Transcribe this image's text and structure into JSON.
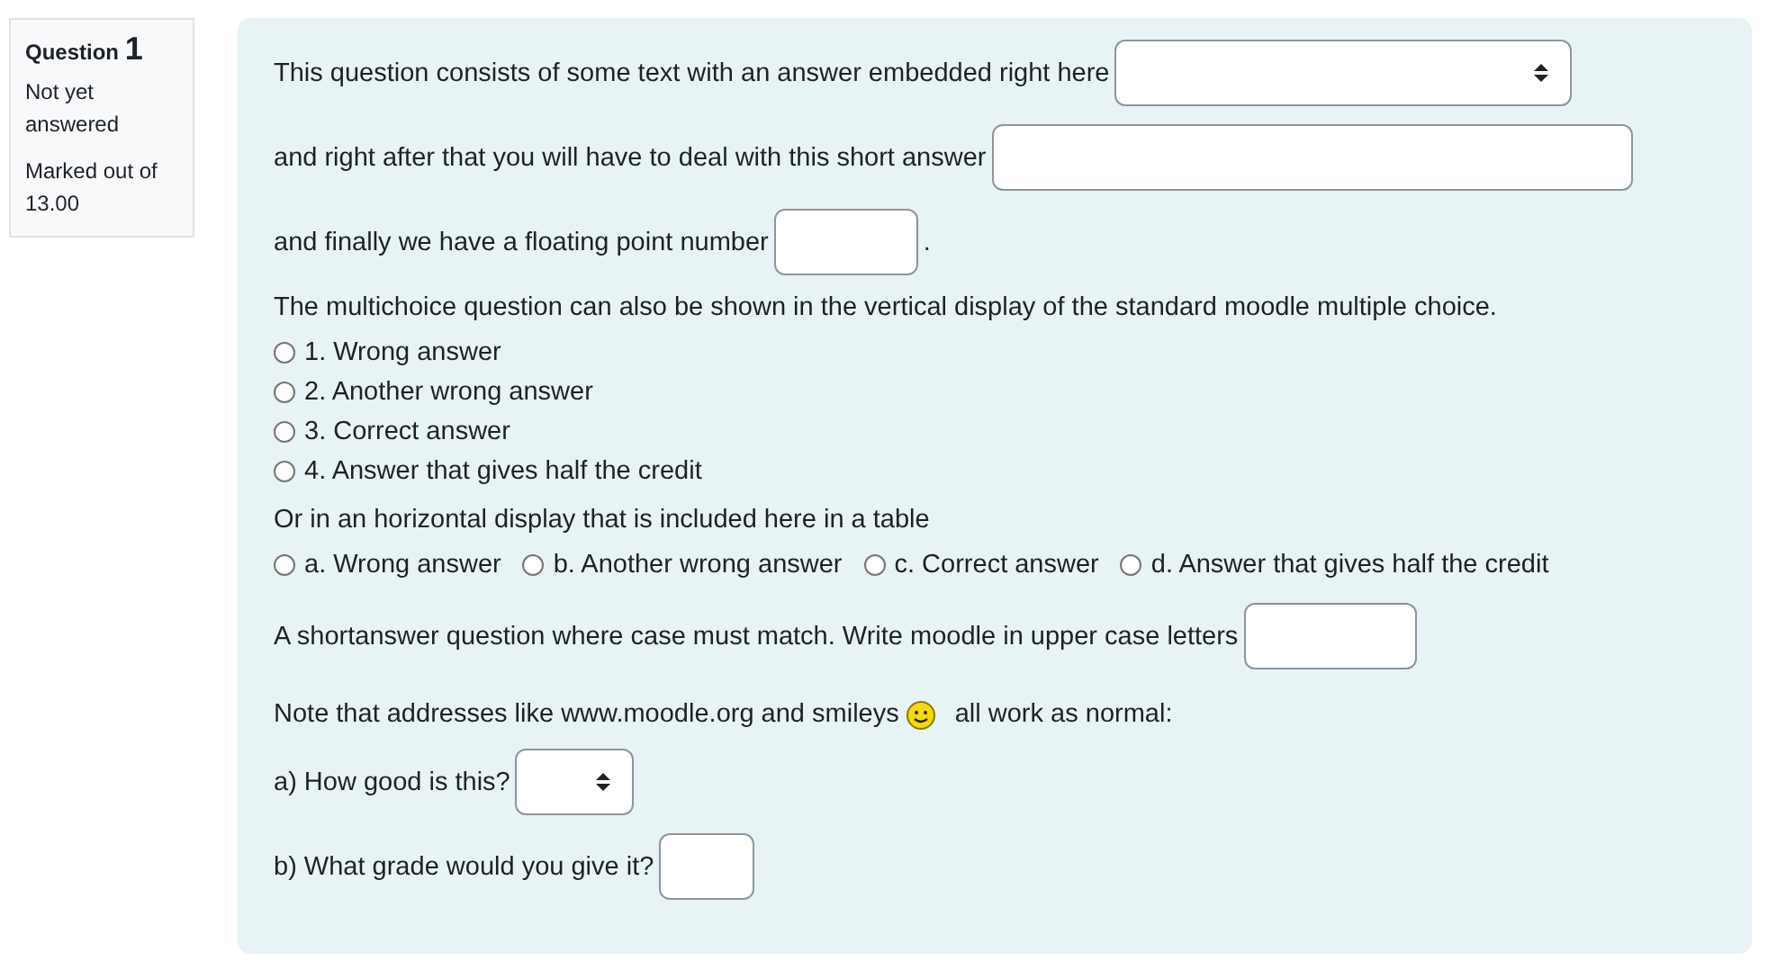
{
  "info": {
    "label": "Question",
    "number": "1",
    "state": "Not yet answered",
    "grade": "Marked out of 13.00"
  },
  "parts": [
    {
      "kind": "select",
      "text": "This question consists of some text with an answer embedded right here"
    },
    {
      "kind": "input",
      "text": "and right after that you will have to deal with this short answer"
    },
    {
      "kind": "input",
      "text": "and finally we have a floating point number",
      "after": "."
    },
    {
      "kind": "para",
      "text": "The multichoice question can also be shown in the vertical display of the standard moodle multiple choice."
    },
    {
      "kind": "vradios",
      "options": [
        {
          "label": "1. Wrong answer",
          "checked": false
        },
        {
          "label": "2. Another wrong answer",
          "checked": false
        },
        {
          "label": "3. Correct answer",
          "checked": false
        },
        {
          "label": "4. Answer that gives half the credit",
          "checked": false
        }
      ]
    },
    {
      "kind": "para",
      "text": "Or in an horizontal display that is included here in a table"
    },
    {
      "kind": "hradios",
      "options": [
        {
          "label": "a. Wrong answer",
          "checked": false
        },
        {
          "label": "b. Another wrong answer",
          "checked": false
        },
        {
          "label": "c. Correct answer",
          "checked": false
        },
        {
          "label": "d. Answer that gives half the credit",
          "checked": false
        }
      ]
    },
    {
      "kind": "input",
      "text": "A shortanswer question where case must match. Write moodle in upper case letters"
    },
    {
      "kind": "smiley",
      "text": "Note that addresses like www.moodle.org and smileys",
      "after": "all work as normal:"
    },
    {
      "kind": "select",
      "text": "a) How good is this?"
    },
    {
      "kind": "input",
      "text": "b) What grade would you give it?"
    }
  ]
}
